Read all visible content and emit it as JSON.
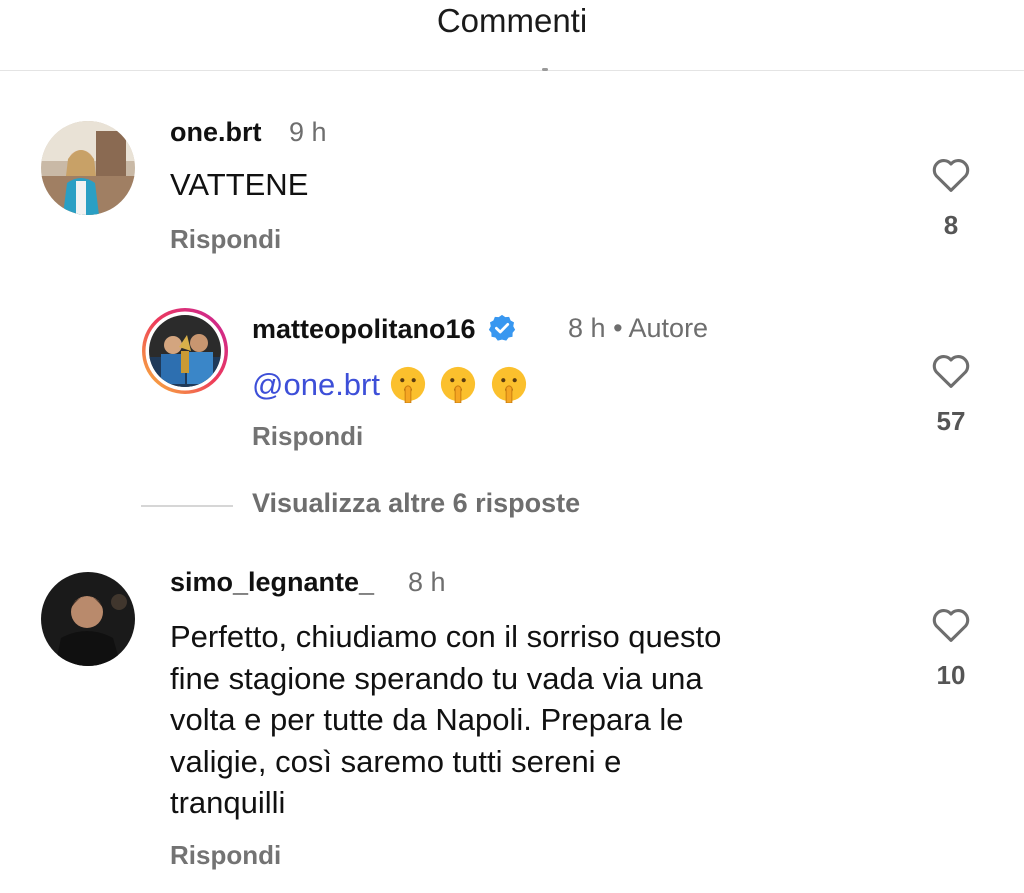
{
  "header": {
    "title": "Commenti"
  },
  "comments": [
    {
      "username": "one.brt",
      "time": "9 h",
      "text": "VATTENE",
      "reply_label": "Rispondi",
      "likes": "8"
    },
    {
      "username": "matteopolitano16",
      "time": "8 h",
      "author_label": "• Autore",
      "mention": "@one.brt",
      "emojis": [
        "shushing-face",
        "shushing-face",
        "shushing-face"
      ],
      "reply_label": "Rispondi",
      "likes": "57"
    },
    {
      "username": "simo_legnante_",
      "time": "8 h",
      "text_lines": [
        "Perfetto, chiudiamo con il sorriso questo",
        "fine stagione sperando tu vada via una",
        "volta e per tutte da Napoli. Prepara le",
        "valigie, così saremo tutti sereni e",
        "tranquilli"
      ],
      "reply_label": "Rispondi",
      "likes": "10"
    }
  ],
  "view_more": "Visualizza altre 6 risposte",
  "colors": {
    "mention": "#3d4fd8",
    "verified": "#3897f0",
    "muted": "#737373"
  }
}
